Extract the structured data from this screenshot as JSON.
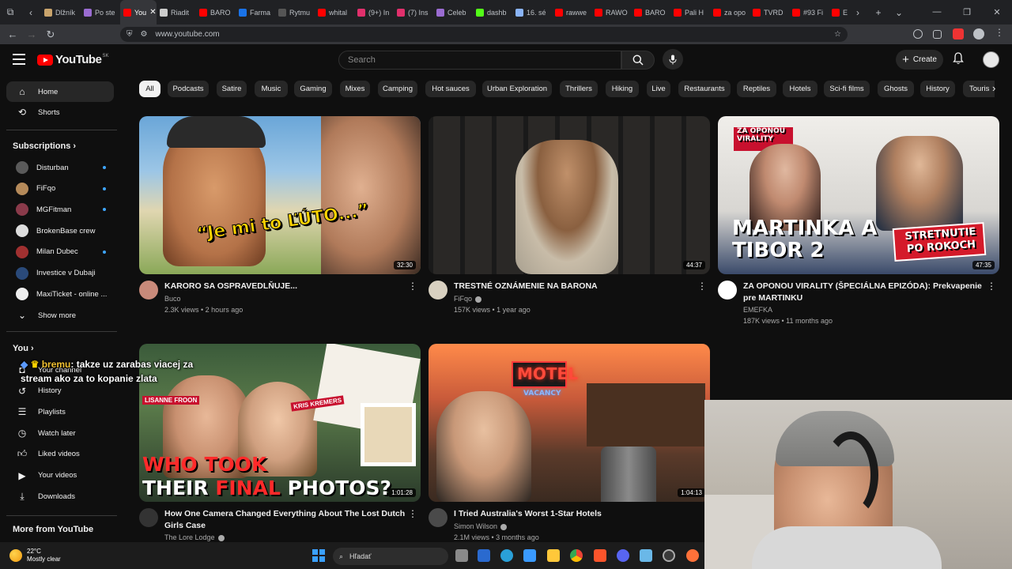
{
  "browser": {
    "tabs": [
      {
        "label": "Dlžník",
        "color": "#c9a46c"
      },
      {
        "label": "Po ste",
        "color": "#9a6cd1"
      },
      {
        "label": "You",
        "color": "#ff0000",
        "active": true
      },
      {
        "label": "Riadit",
        "color": "#cccccc"
      },
      {
        "label": "BARO",
        "color": "#ff0000"
      },
      {
        "label": "Farma",
        "color": "#1a73e8"
      },
      {
        "label": "Rytmu",
        "color": "#555555"
      },
      {
        "label": "whital",
        "color": "#ff0000"
      },
      {
        "label": "(9+) In",
        "color": "#e1306c"
      },
      {
        "label": "(7) Ins",
        "color": "#e1306c"
      },
      {
        "label": "Celeb",
        "color": "#9a6cd1"
      },
      {
        "label": "dashb",
        "color": "#53fc18"
      },
      {
        "label": "16. sé",
        "color": "#8ab4f8"
      },
      {
        "label": "rawwe",
        "color": "#ff0000"
      },
      {
        "label": "RAWO",
        "color": "#ff0000"
      },
      {
        "label": "BARO",
        "color": "#ff0000"
      },
      {
        "label": "Pali H",
        "color": "#ff0000"
      },
      {
        "label": "za opo",
        "color": "#ff0000"
      },
      {
        "label": "TVRD",
        "color": "#ff0000"
      },
      {
        "label": "#93 Fi",
        "color": "#ff0000"
      },
      {
        "label": "Ev",
        "color": "#ff0000"
      }
    ],
    "url": "www.youtube.com"
  },
  "header": {
    "logo": "YouTube",
    "country": "SK",
    "search_placeholder": "Search",
    "create_label": "Create"
  },
  "sidebar": {
    "main": [
      {
        "label": "Home",
        "icon": "home-icon"
      },
      {
        "label": "Shorts",
        "icon": "shorts-icon"
      }
    ],
    "subscriptions_title": "Subscriptions",
    "subscriptions": [
      {
        "label": "Disturban",
        "color": "#5a5a5a",
        "dot": true
      },
      {
        "label": "FiFqo",
        "color": "#b58a5a",
        "dot": true
      },
      {
        "label": "MGFitman",
        "color": "#8a3a4a",
        "dot": true
      },
      {
        "label": "BrokenBase crew",
        "color": "#dddddd",
        "dot": false
      },
      {
        "label": "Milan Dubec",
        "color": "#a03030",
        "dot": true
      },
      {
        "label": "Investice v Dubaji",
        "color": "#2a4a7a",
        "dot": false
      },
      {
        "label": "MaxiTicket - online ...",
        "color": "#eeeeee",
        "dot": false
      }
    ],
    "show_more": "Show more",
    "you_title": "You",
    "you_items": [
      {
        "label": "Your channel",
        "icon": "user-icon"
      },
      {
        "label": "History",
        "icon": "history-icon"
      },
      {
        "label": "Playlists",
        "icon": "playlists-icon"
      },
      {
        "label": "Watch later",
        "icon": "clock-icon"
      },
      {
        "label": "Liked videos",
        "icon": "thumb-up-icon"
      },
      {
        "label": "Your videos",
        "icon": "video-icon"
      },
      {
        "label": "Downloads",
        "icon": "download-icon"
      }
    ],
    "more_title": "More from YouTube"
  },
  "chips": [
    "All",
    "Podcasts",
    "Satire",
    "Music",
    "Gaming",
    "Mixes",
    "Camping",
    "Hot sauces",
    "Urban Exploration",
    "Thrillers",
    "Hiking",
    "Live",
    "Restaurants",
    "Reptiles",
    "Hotels",
    "Sci-fi films",
    "Ghosts",
    "History",
    "Touris"
  ],
  "videos": [
    {
      "title": "KARORO SA OSPRAVEDLŇUJE...",
      "channel": "Buco",
      "verified": false,
      "stats": "2.3K views • 2 hours ago",
      "duration": "32:30",
      "thumb_text": "“Je mi to ĽÚTO...”",
      "avatar_color": "#c98a7a"
    },
    {
      "title": "TRESTNÉ OZNÁMENIE NA BARONA",
      "channel": "FiFqo",
      "verified": true,
      "stats": "157K views • 1 year ago",
      "duration": "44:37",
      "thumb_text": "",
      "avatar_color": "#d8d0c0"
    },
    {
      "title": "ZA OPONOU VIRALITY (ŠPECIÁLNA EPIZÓDA): Prekvapenie pre MARTINKU",
      "channel": "EMEFKA",
      "verified": false,
      "stats": "187K views • 11 months ago",
      "duration": "47:35",
      "thumb_text": "MARTINKA A TIBOR 2",
      "thumb_badge": "ZA OPONOU VIRALITY",
      "thumb_tag": "STRETNUTIE PO ROKOCH",
      "avatar_color": "#ffffff"
    },
    {
      "title": "How One Camera Changed Everything About The Lost Dutch Girls Case",
      "channel": "The Lore Lodge",
      "verified": true,
      "stats": "",
      "duration": "1:01:28",
      "thumb_text_a": "WHO TOOK",
      "thumb_text_b": "THEIR",
      "thumb_text_c": "FINAL",
      "thumb_text_d": "PHOTOS?",
      "thumb_label1": "LISANNE FROON",
      "thumb_label2": "KRIS KREMERS",
      "avatar_color": "#333333"
    },
    {
      "title": "I Tried Australia's Worst 1-Star Hotels",
      "channel": "Simon Wilson",
      "verified": true,
      "stats": "2.1M views • 3 months ago",
      "duration": "1:04:13",
      "thumb_sign": "MOTEL",
      "thumb_sign2": "VACANCY",
      "avatar_color": "#4a4a4a"
    }
  ],
  "chat": {
    "user": "bremu",
    "message": ": takze uz zarabas viacej za stream ako za to kopanie zlata"
  },
  "taskbar": {
    "temp": "22°C",
    "weather": "Mostly clear",
    "search": "Hľadať"
  }
}
